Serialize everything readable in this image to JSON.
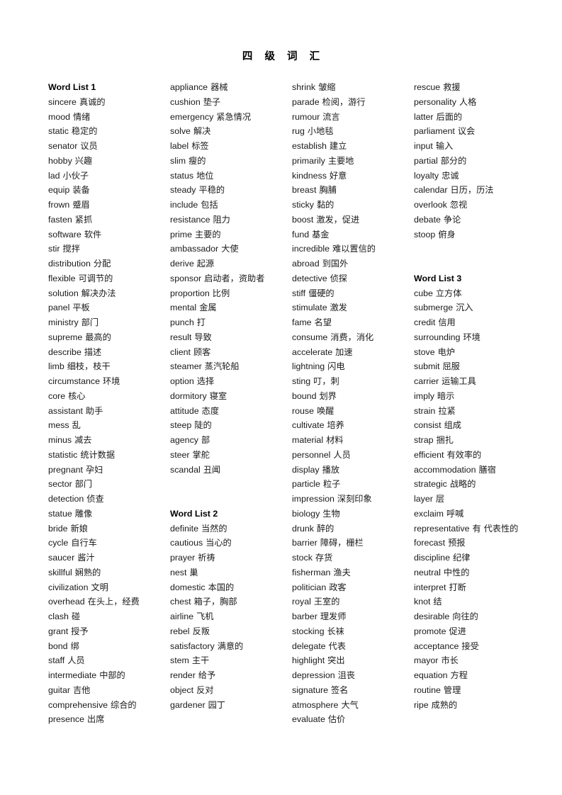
{
  "document": {
    "title": "四 级 词 汇"
  },
  "columns": [
    {
      "id": "column-1",
      "entries": [
        {
          "type": "heading",
          "text": "Word List 1"
        },
        {
          "type": "entry",
          "word": "sincere",
          "zh": "真诚的"
        },
        {
          "type": "entry",
          "word": "mood",
          "zh": "情绪"
        },
        {
          "type": "entry",
          "word": "static",
          "zh": "稳定的"
        },
        {
          "type": "entry",
          "word": "senator",
          "zh": "议员"
        },
        {
          "type": "entry",
          "word": "hobby",
          "zh": "兴趣"
        },
        {
          "type": "entry",
          "word": "lad",
          "zh": "小伙子"
        },
        {
          "type": "entry",
          "word": "equip",
          "zh": "装备"
        },
        {
          "type": "entry",
          "word": "frown",
          "zh": "蹙眉"
        },
        {
          "type": "entry",
          "word": "fasten",
          "zh": "紧抓"
        },
        {
          "type": "entry",
          "word": "software",
          "zh": "软件"
        },
        {
          "type": "entry",
          "word": "stir",
          "zh": "搅拌"
        },
        {
          "type": "entry",
          "word": "distribution",
          "zh": "分配"
        },
        {
          "type": "entry",
          "word": "flexible",
          "zh": "可调节的"
        },
        {
          "type": "entry",
          "word": "solution",
          "zh": "解决办法"
        },
        {
          "type": "entry",
          "word": "panel",
          "zh": "平板"
        },
        {
          "type": "entry",
          "word": "ministry",
          "zh": "部门"
        },
        {
          "type": "entry",
          "word": "supreme",
          "zh": "最高的"
        },
        {
          "type": "entry",
          "word": "describe",
          "zh": "描述"
        },
        {
          "type": "entry",
          "word": "limb",
          "zh": "细枝，枝干"
        },
        {
          "type": "entry",
          "word": "circumstance",
          "zh": "环境"
        },
        {
          "type": "entry",
          "word": "core",
          "zh": "核心"
        },
        {
          "type": "entry",
          "word": "assistant",
          "zh": "助手"
        },
        {
          "type": "entry",
          "word": "mess",
          "zh": "乱"
        },
        {
          "type": "entry",
          "word": "minus",
          "zh": "减去"
        },
        {
          "type": "entry",
          "word": "statistic",
          "zh": "统计数据"
        },
        {
          "type": "entry",
          "word": "pregnant",
          "zh": "孕妇"
        },
        {
          "type": "entry",
          "word": "sector",
          "zh": "部门"
        },
        {
          "type": "entry",
          "word": "detection",
          "zh": "侦查"
        },
        {
          "type": "entry",
          "word": "statue",
          "zh": "雕像"
        },
        {
          "type": "entry",
          "word": "bride",
          "zh": "新娘"
        },
        {
          "type": "entry",
          "word": "cycle",
          "zh": "自行车"
        },
        {
          "type": "entry",
          "word": "saucer",
          "zh": "酱汁"
        },
        {
          "type": "entry",
          "word": "skillful",
          "zh": "娴熟的"
        },
        {
          "type": "entry",
          "word": "civilization",
          "zh": "文明"
        },
        {
          "type": "entry",
          "word": "overhead",
          "zh": "在头上，经费"
        },
        {
          "type": "entry",
          "word": "clash",
          "zh": "碰"
        },
        {
          "type": "entry",
          "word": "grant",
          "zh": "授予"
        },
        {
          "type": "entry",
          "word": "bond",
          "zh": "绑"
        },
        {
          "type": "entry",
          "word": "staff",
          "zh": "人员"
        },
        {
          "type": "entry",
          "word": "intermediate",
          "zh": "中部的"
        },
        {
          "type": "entry",
          "word": "guitar",
          "zh": "吉他"
        },
        {
          "type": "entry",
          "word": "comprehensive",
          "zh": "综合的"
        },
        {
          "type": "entry",
          "word": "presence",
          "zh": "出席"
        }
      ]
    },
    {
      "id": "column-2",
      "entries": [
        {
          "type": "entry",
          "word": "appliance",
          "zh": "器械"
        },
        {
          "type": "entry",
          "word": "cushion",
          "zh": "垫子"
        },
        {
          "type": "entry",
          "word": "emergency",
          "zh": "紧急情况"
        },
        {
          "type": "entry",
          "word": "solve",
          "zh": "解决"
        },
        {
          "type": "entry",
          "word": "label",
          "zh": "标签"
        },
        {
          "type": "entry",
          "word": "slim",
          "zh": "瘦的"
        },
        {
          "type": "entry",
          "word": "status",
          "zh": "地位"
        },
        {
          "type": "entry",
          "word": "steady",
          "zh": "平稳的"
        },
        {
          "type": "entry",
          "word": "include",
          "zh": "包括"
        },
        {
          "type": "entry",
          "word": "resistance",
          "zh": "阻力"
        },
        {
          "type": "entry",
          "word": "prime",
          "zh": "主要的"
        },
        {
          "type": "entry",
          "word": "ambassador",
          "zh": "大使"
        },
        {
          "type": "entry",
          "word": "derive",
          "zh": "起源"
        },
        {
          "type": "entry",
          "word": "sponsor",
          "zh": "启动者，资助者"
        },
        {
          "type": "entry",
          "word": "proportion",
          "zh": "比例"
        },
        {
          "type": "entry",
          "word": "mental",
          "zh": "金属"
        },
        {
          "type": "entry",
          "word": "punch",
          "zh": "打"
        },
        {
          "type": "entry",
          "word": "result",
          "zh": "导致"
        },
        {
          "type": "entry",
          "word": "client",
          "zh": "顾客"
        },
        {
          "type": "entry",
          "word": "steamer",
          "zh": "蒸汽轮船"
        },
        {
          "type": "entry",
          "word": "option",
          "zh": "选择"
        },
        {
          "type": "entry",
          "word": "dormitory",
          "zh": "寝室"
        },
        {
          "type": "entry",
          "word": "attitude",
          "zh": "态度"
        },
        {
          "type": "entry",
          "word": "steep",
          "zh": "陡的"
        },
        {
          "type": "entry",
          "word": "agency",
          "zh": "部"
        },
        {
          "type": "entry",
          "word": "steer",
          "zh": "掌舵"
        },
        {
          "type": "entry",
          "word": "scandal",
          "zh": "丑闻"
        },
        {
          "type": "spacer"
        },
        {
          "type": "spacer"
        },
        {
          "type": "heading",
          "text": "Word List 2"
        },
        {
          "type": "entry",
          "word": "definite",
          "zh": "当然的"
        },
        {
          "type": "entry",
          "word": "cautious",
          "zh": "当心的"
        },
        {
          "type": "entry",
          "word": "prayer",
          "zh": "祈祷"
        },
        {
          "type": "entry",
          "word": "nest",
          "zh": "巢"
        },
        {
          "type": "entry",
          "word": "domestic",
          "zh": "本国的"
        },
        {
          "type": "entry",
          "word": "chest",
          "zh": "箱子，胸部"
        },
        {
          "type": "entry",
          "word": "airline",
          "zh": "飞机"
        },
        {
          "type": "entry",
          "word": "rebel",
          "zh": "反叛"
        },
        {
          "type": "entry",
          "word": "satisfactory",
          "zh": "满意的"
        },
        {
          "type": "entry",
          "word": "stem",
          "zh": "主干"
        },
        {
          "type": "entry",
          "word": "render",
          "zh": "给予"
        },
        {
          "type": "entry",
          "word": "object",
          "zh": "反对"
        },
        {
          "type": "entry",
          "word": "gardener",
          "zh": "园丁"
        }
      ]
    },
    {
      "id": "column-3",
      "entries": [
        {
          "type": "entry",
          "word": "shrink",
          "zh": "皱缩"
        },
        {
          "type": "entry",
          "word": "parade",
          "zh": "检阅，游行"
        },
        {
          "type": "entry",
          "word": "rumour",
          "zh": "流言"
        },
        {
          "type": "entry",
          "word": "rug",
          "zh": "小地毯"
        },
        {
          "type": "entry",
          "word": "establish",
          "zh": "建立"
        },
        {
          "type": "entry",
          "word": "primarily",
          "zh": "主要地"
        },
        {
          "type": "entry",
          "word": "kindness",
          "zh": "好意"
        },
        {
          "type": "entry",
          "word": "breast",
          "zh": "胸脯"
        },
        {
          "type": "entry",
          "word": "sticky",
          "zh": "黏的"
        },
        {
          "type": "entry",
          "word": "boost",
          "zh": "激发，促进"
        },
        {
          "type": "entry",
          "word": "fund",
          "zh": "基金"
        },
        {
          "type": "entry",
          "word": "incredible",
          "zh": "难以置信的"
        },
        {
          "type": "entry",
          "word": "abroad",
          "zh": "到国外"
        },
        {
          "type": "entry",
          "word": "detective",
          "zh": "侦探"
        },
        {
          "type": "entry",
          "word": "stiff",
          "zh": "僵硬的"
        },
        {
          "type": "entry",
          "word": "stimulate",
          "zh": "激发"
        },
        {
          "type": "entry",
          "word": "fame",
          "zh": "名望"
        },
        {
          "type": "entry",
          "word": "consume",
          "zh": "消费，消化"
        },
        {
          "type": "entry",
          "word": "accelerate",
          "zh": "加速"
        },
        {
          "type": "entry",
          "word": "lightning",
          "zh": "闪电"
        },
        {
          "type": "entry",
          "word": "sting",
          "zh": "叮，刺"
        },
        {
          "type": "entry",
          "word": "bound",
          "zh": "划界"
        },
        {
          "type": "entry",
          "word": "rouse",
          "zh": "唤醒"
        },
        {
          "type": "entry",
          "word": "cultivate",
          "zh": "培养"
        },
        {
          "type": "entry",
          "word": "material",
          "zh": "材料"
        },
        {
          "type": "entry",
          "word": "personnel",
          "zh": "人员"
        },
        {
          "type": "entry",
          "word": "display",
          "zh": "播放"
        },
        {
          "type": "entry",
          "word": "particle",
          "zh": "粒子"
        },
        {
          "type": "entry",
          "word": "impression",
          "zh": "深刻印象"
        },
        {
          "type": "entry",
          "word": "biology",
          "zh": "生物"
        },
        {
          "type": "entry",
          "word": "drunk",
          "zh": "醉的"
        },
        {
          "type": "entry",
          "word": "barrier",
          "zh": "障碍，栅栏"
        },
        {
          "type": "entry",
          "word": "stock",
          "zh": "存货"
        },
        {
          "type": "entry",
          "word": "fisherman",
          "zh": "渔夫"
        },
        {
          "type": "entry",
          "word": "politician",
          "zh": "政客"
        },
        {
          "type": "entry",
          "word": "royal",
          "zh": "王室的"
        },
        {
          "type": "entry",
          "word": "barber",
          "zh": "理发师"
        },
        {
          "type": "entry",
          "word": "stocking",
          "zh": "长袜"
        },
        {
          "type": "entry",
          "word": "delegate",
          "zh": "代表"
        },
        {
          "type": "entry",
          "word": "highlight",
          "zh": "突出"
        },
        {
          "type": "entry",
          "word": "depression",
          "zh": "沮丧"
        },
        {
          "type": "entry",
          "word": "signature",
          "zh": "签名"
        },
        {
          "type": "entry",
          "word": "atmosphere",
          "zh": "大气"
        },
        {
          "type": "entry",
          "word": "evaluate",
          "zh": "估价"
        }
      ]
    },
    {
      "id": "column-4",
      "entries": [
        {
          "type": "entry",
          "word": "rescue",
          "zh": "救援"
        },
        {
          "type": "entry",
          "word": "personality",
          "zh": "人格"
        },
        {
          "type": "entry",
          "word": "latter",
          "zh": "后面的"
        },
        {
          "type": "entry",
          "word": "parliament",
          "zh": "议会"
        },
        {
          "type": "entry",
          "word": "input",
          "zh": "输入"
        },
        {
          "type": "entry",
          "word": "partial",
          "zh": "部分的"
        },
        {
          "type": "entry",
          "word": "loyalty",
          "zh": "忠诚"
        },
        {
          "type": "entry",
          "word": "calendar",
          "zh": "日历，历法"
        },
        {
          "type": "entry",
          "word": "overlook",
          "zh": "忽视"
        },
        {
          "type": "entry",
          "word": "debate",
          "zh": "争论"
        },
        {
          "type": "entry",
          "word": "stoop",
          "zh": "俯身"
        },
        {
          "type": "spacer"
        },
        {
          "type": "spacer"
        },
        {
          "type": "heading",
          "text": "Word List 3"
        },
        {
          "type": "entry",
          "word": "cube",
          "zh": "立方体"
        },
        {
          "type": "entry",
          "word": "submerge",
          "zh": "沉入"
        },
        {
          "type": "entry",
          "word": "credit",
          "zh": "信用"
        },
        {
          "type": "entry",
          "word": "surrounding",
          "zh": "环境"
        },
        {
          "type": "entry",
          "word": "stove",
          "zh": "电炉"
        },
        {
          "type": "entry",
          "word": "submit",
          "zh": "屈服"
        },
        {
          "type": "entry",
          "word": "carrier",
          "zh": "运输工具"
        },
        {
          "type": "entry",
          "word": "imply",
          "zh": "暗示"
        },
        {
          "type": "entry",
          "word": "strain",
          "zh": "拉紧"
        },
        {
          "type": "entry",
          "word": "consist",
          "zh": "组成"
        },
        {
          "type": "entry",
          "word": "strap",
          "zh": "捆扎"
        },
        {
          "type": "entry",
          "word": "efficient",
          "zh": "有效率的"
        },
        {
          "type": "entry",
          "word": "accommodation",
          "zh": "膳宿"
        },
        {
          "type": "entry",
          "word": "strategic",
          "zh": "战略的"
        },
        {
          "type": "entry",
          "word": "layer",
          "zh": "层"
        },
        {
          "type": "entry",
          "word": "exclaim",
          "zh": "呼喊"
        },
        {
          "type": "entry",
          "word": "representative",
          "zh": "有 代表性的",
          "justify": true
        },
        {
          "type": "entry",
          "word": "forecast",
          "zh": "预报"
        },
        {
          "type": "entry",
          "word": "discipline",
          "zh": "纪律"
        },
        {
          "type": "entry",
          "word": "neutral",
          "zh": "中性的"
        },
        {
          "type": "entry",
          "word": "interpret",
          "zh": "打断"
        },
        {
          "type": "entry",
          "word": "knot",
          "zh": "结"
        },
        {
          "type": "entry",
          "word": "desirable",
          "zh": "向往的"
        },
        {
          "type": "entry",
          "word": "promote",
          "zh": "促进"
        },
        {
          "type": "entry",
          "word": "acceptance",
          "zh": "接受"
        },
        {
          "type": "entry",
          "word": "mayor",
          "zh": "市长"
        },
        {
          "type": "entry",
          "word": "equation",
          "zh": "方程"
        },
        {
          "type": "entry",
          "word": "routine",
          "zh": "管理"
        },
        {
          "type": "entry",
          "word": "ripe",
          "zh": "成熟的"
        }
      ]
    }
  ]
}
